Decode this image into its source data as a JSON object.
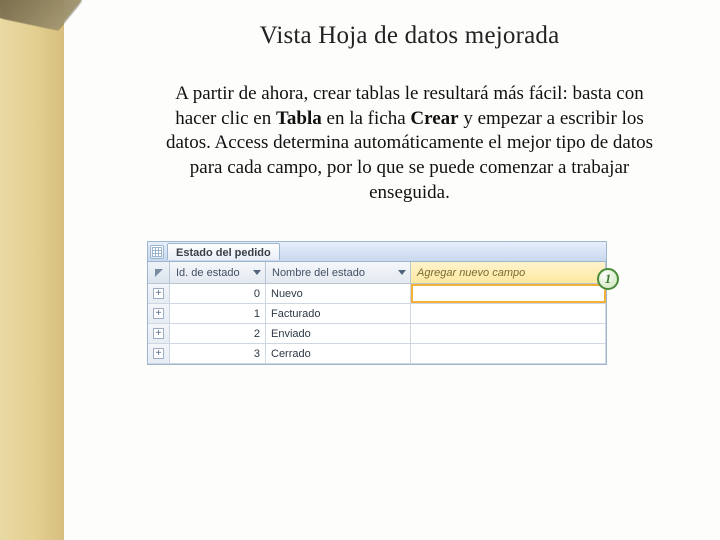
{
  "title": "Vista Hoja de datos mejorada",
  "body": {
    "pre": "A partir de ahora, crear tablas le resultará más fácil: basta con hacer clic en ",
    "b1": "Tabla",
    "mid": " en la ficha ",
    "b2": "Crear",
    "post": " y empezar a escribir los datos. Access determina automáticamente el mejor tipo de datos para cada campo, por lo que se puede comenzar a trabajar enseguida."
  },
  "datasheet": {
    "tab_label": "Estado del pedido",
    "columns": {
      "id": "Id. de estado",
      "name": "Nombre del estado",
      "add": "Agregar nuevo campo"
    },
    "callout": "1",
    "rows": [
      {
        "id": "0",
        "name": "Nuevo"
      },
      {
        "id": "1",
        "name": "Facturado"
      },
      {
        "id": "2",
        "name": "Enviado"
      },
      {
        "id": "3",
        "name": "Cerrado"
      }
    ]
  }
}
